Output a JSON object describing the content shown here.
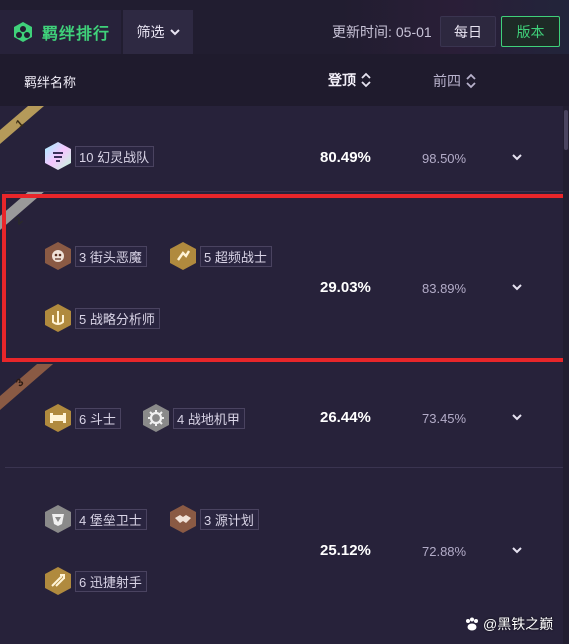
{
  "topbar": {
    "title": "羁绊排行",
    "filter_label": "筛选",
    "update_label": "更新时间:",
    "update_value": "05-01",
    "daily_label": "每日",
    "version_label": "版本",
    "accent_color": "#3fd17a"
  },
  "table": {
    "col_name": "羁绊名称",
    "col_top1": "登顶",
    "col_top4": "前四"
  },
  "rows": [
    {
      "rank": "1",
      "rank_color": "#b59a5a",
      "traits": [
        {
          "label": "10 幻灵战队",
          "tier": "prismatic",
          "icon": "star-guardian-icon"
        }
      ],
      "top1": "80.49%",
      "top4": "98.50%"
    },
    {
      "rank": "2",
      "rank_color": "#9a9a9a",
      "traits": [
        {
          "label": "3 街头恶魔",
          "tier": "bronze",
          "icon": "demon-icon"
        },
        {
          "label": "5 超频战士",
          "tier": "gold",
          "icon": "overclock-icon"
        },
        {
          "label": "5 战略分析师",
          "tier": "gold",
          "icon": "strategist-icon"
        }
      ],
      "top1": "29.03%",
      "top4": "83.89%"
    },
    {
      "rank": "3",
      "rank_color": "#8a5a44",
      "traits": [
        {
          "label": "6 斗士",
          "tier": "gold",
          "icon": "bruiser-icon"
        },
        {
          "label": "4 战地机甲",
          "tier": "silver",
          "icon": "mech-icon"
        }
      ],
      "top1": "26.44%",
      "top4": "73.45%"
    },
    {
      "rank": "",
      "rank_color": "",
      "traits": [
        {
          "label": "4 堡垒卫士",
          "tier": "silver",
          "icon": "bastion-icon"
        },
        {
          "label": "3 源计划",
          "tier": "bronze",
          "icon": "handshake-icon"
        },
        {
          "label": "6 迅捷射手",
          "tier": "gold",
          "icon": "rapidfire-icon"
        }
      ],
      "top1": "25.12%",
      "top4": "72.88%"
    }
  ],
  "watermark": "@黑铁之巅"
}
